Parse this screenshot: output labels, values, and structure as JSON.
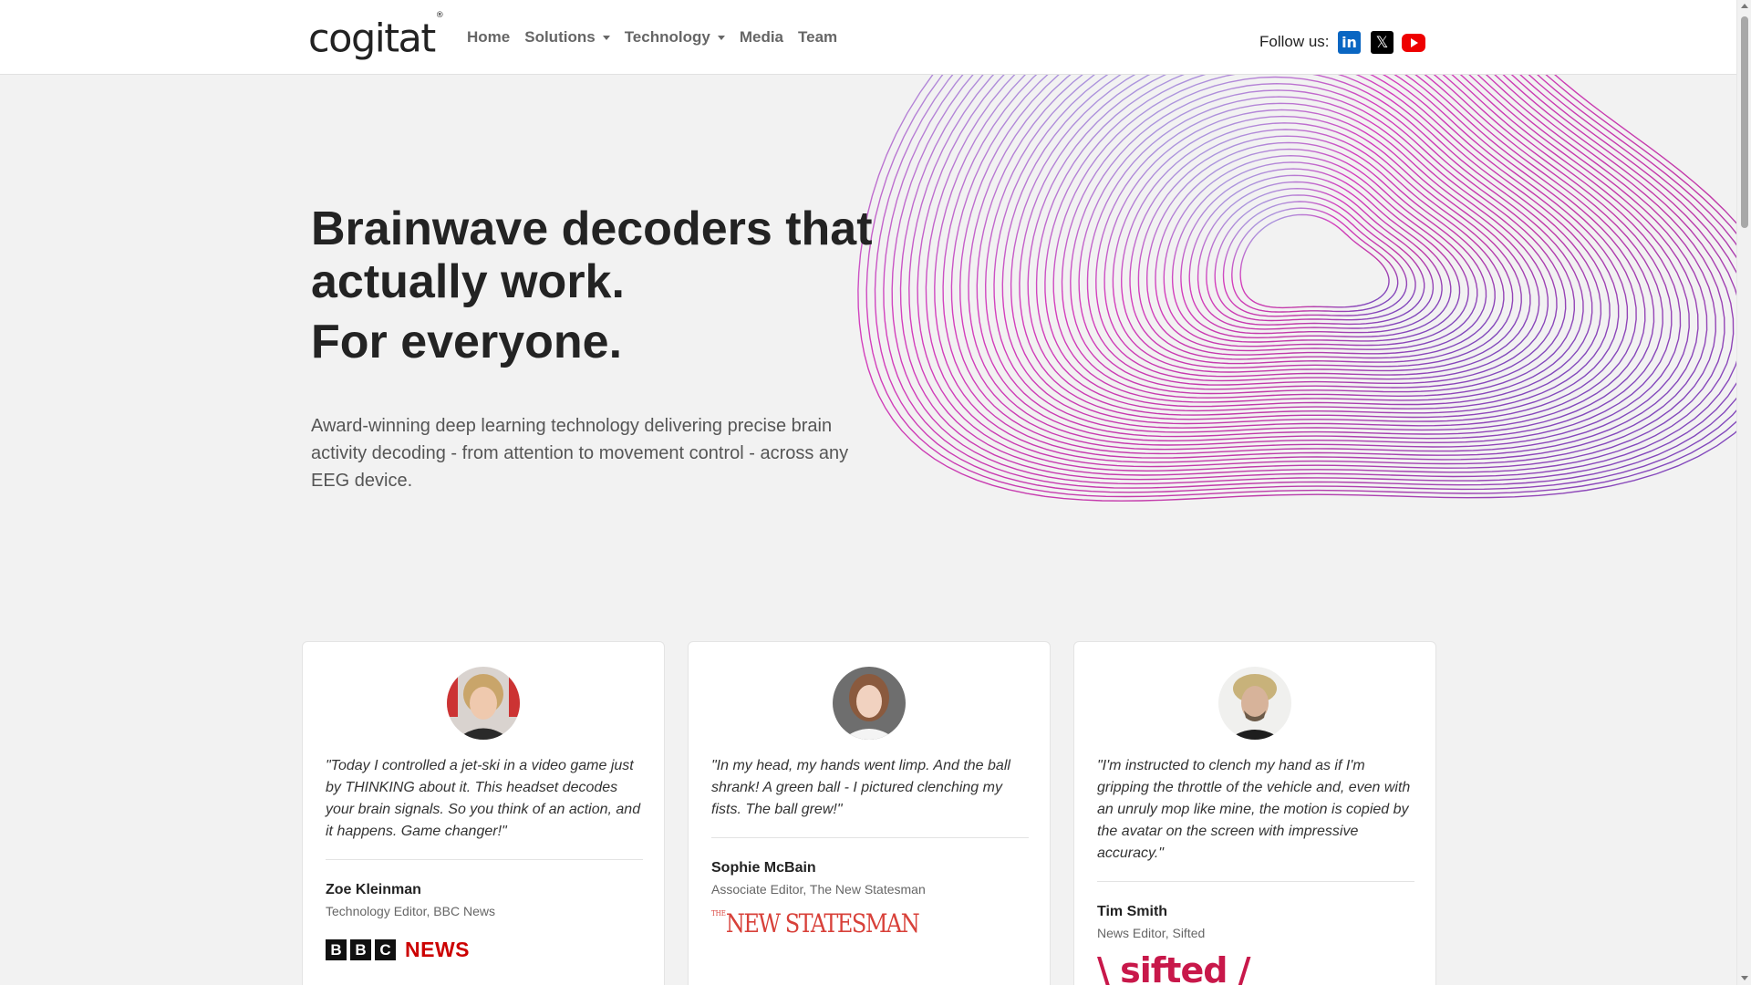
{
  "header": {
    "logo_text": "cogitat",
    "logo_mark": "®",
    "nav": [
      {
        "label": "Home"
      },
      {
        "label": "Solutions"
      },
      {
        "label": "Technology"
      },
      {
        "label": "Media"
      },
      {
        "label": "Team"
      }
    ],
    "follow_label": "Follow us:",
    "social": [
      {
        "icon": "linkedin-icon",
        "glyph": "in",
        "color": "#0a66c2"
      },
      {
        "icon": "x-twitter-icon",
        "glyph": "𝕏",
        "color": "#000000"
      },
      {
        "icon": "youtube-icon",
        "color": "#ee0000"
      }
    ]
  },
  "hero": {
    "title_line1": "Brainwave decoders that",
    "title_line2": "actually work.",
    "title_line3": "For everyone.",
    "subtitle": "Award-winning deep learning technology delivering precise brain activity decoding - from attention to movement control - across any EEG device."
  },
  "testimonials": [
    {
      "quote": "\"Today I controlled a jet-ski in a video game just by THINKING about it. This headset decodes your brain signals. So you think of an action, and it happens. Game changer!\"",
      "name": "Zoe Kleinman",
      "role": "Technology Editor, BBC News",
      "publication": {
        "box1": "B",
        "box2": "B",
        "box3": "C",
        "word": "NEWS"
      }
    },
    {
      "quote": "\"In my head, my hands went limp. And the ball shrank! A green ball - I pictured clenching my fists. The ball grew!\"",
      "name": "Sophie McBain",
      "role": "Associate Editor, The New Statesman",
      "publication": {
        "small": "THE",
        "word": "NEW STATESMAN"
      }
    },
    {
      "quote": "\"I'm instructed to clench my hand as if I'm gripping the throttle of the vehicle and, even with an unruly mop like mine, the motion is copied by the avatar on the screen with impressive accuracy.\"",
      "name": "Tim Smith",
      "role": "News Editor, Sifted",
      "publication": {
        "word": "\\ sifted /"
      }
    }
  ],
  "colors": {
    "accent_wave_start": "#8fd3f4",
    "accent_wave_mid": "#d43fbd",
    "accent_wave_end": "#6a4fc4",
    "bbc_red": "#cc0000",
    "new_statesman_red": "#d8413a",
    "sifted_pink": "#c8184a"
  }
}
